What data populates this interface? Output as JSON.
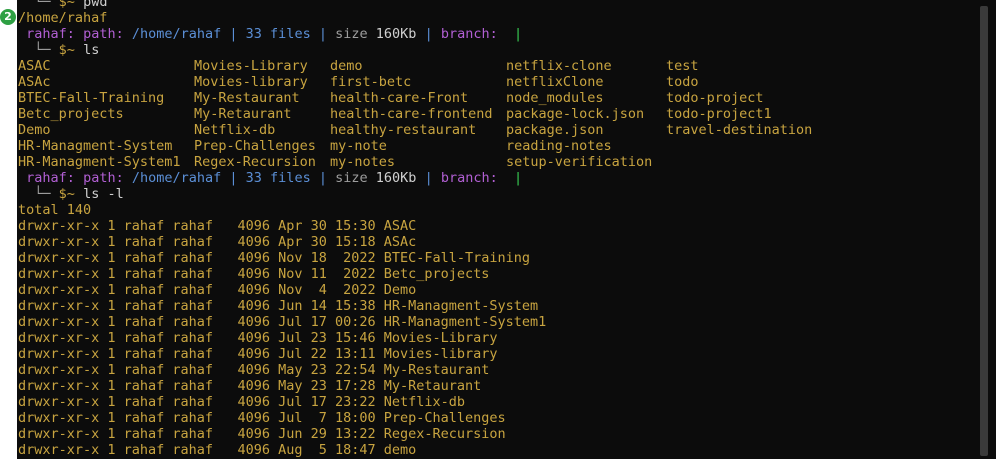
{
  "window": {
    "notification_count": "2"
  },
  "prompt": {
    "tree": "└─",
    "symbol": "$~"
  },
  "commands": {
    "pwd": "pwd",
    "ls": "ls",
    "ls_l": "ls -l"
  },
  "pwd_output": "/home/rahaf",
  "status": {
    "user": "rahaf:",
    "path_label": "path:",
    "path": "/home/rahaf",
    "sep": "|",
    "files": "33 files",
    "size_label": "size",
    "size_value": "160Kb",
    "branch_label": "branch:",
    "cursor": "|"
  },
  "ls_columns": [
    [
      "ASAC",
      "ASAc",
      "BTEC-Fall-Training",
      "Betc_projects",
      "Demo",
      "HR-Managment-System",
      "HR-Managment-System1"
    ],
    [
      "Movies-Library",
      "Movies-library",
      "My-Restaurant",
      "My-Retaurant",
      "Netflix-db",
      "Prep-Challenges",
      "Regex-Recursion"
    ],
    [
      "demo",
      "first-betc",
      "health-care-Front",
      "health-care-frontend",
      "healthy-restaurant",
      "my-note",
      "my-notes"
    ],
    [
      "netflix-clone",
      "netflixClone",
      "node_modules",
      "package-lock.json",
      "package.json",
      "reading-notes",
      "setup-verification"
    ],
    [
      "test",
      "todo",
      "todo-project",
      "todo-project1",
      "travel-destination",
      "",
      ""
    ]
  ],
  "ls_l_total": "total 140",
  "ls_l_rows": [
    "drwxr-xr-x 1 rahaf rahaf   4096 Apr 30 15:30 ASAC",
    "drwxr-xr-x 1 rahaf rahaf   4096 Apr 30 15:18 ASAc",
    "drwxr-xr-x 1 rahaf rahaf   4096 Nov 18  2022 BTEC-Fall-Training",
    "drwxr-xr-x 1 rahaf rahaf   4096 Nov 11  2022 Betc_projects",
    "drwxr-xr-x 1 rahaf rahaf   4096 Nov  4  2022 Demo",
    "drwxr-xr-x 1 rahaf rahaf   4096 Jun 14 15:38 HR-Managment-System",
    "drwxr-xr-x 1 rahaf rahaf   4096 Jul 17 00:26 HR-Managment-System1",
    "drwxr-xr-x 1 rahaf rahaf   4096 Jul 23 15:46 Movies-Library",
    "drwxr-xr-x 1 rahaf rahaf   4096 Jul 22 13:11 Movies-library",
    "drwxr-xr-x 1 rahaf rahaf   4096 May 23 22:54 My-Restaurant",
    "drwxr-xr-x 1 rahaf rahaf   4096 May 23 17:28 My-Retaurant",
    "drwxr-xr-x 1 rahaf rahaf   4096 Jul 17 23:22 Netflix-db",
    "drwxr-xr-x 1 rahaf rahaf   4096 Jul  7 18:00 Prep-Challenges",
    "drwxr-xr-x 1 rahaf rahaf   4096 Jun 29 13:22 Regex-Recursion",
    "drwxr-xr-x 1 rahaf rahaf   4096 Aug  5 18:47 demo"
  ]
}
